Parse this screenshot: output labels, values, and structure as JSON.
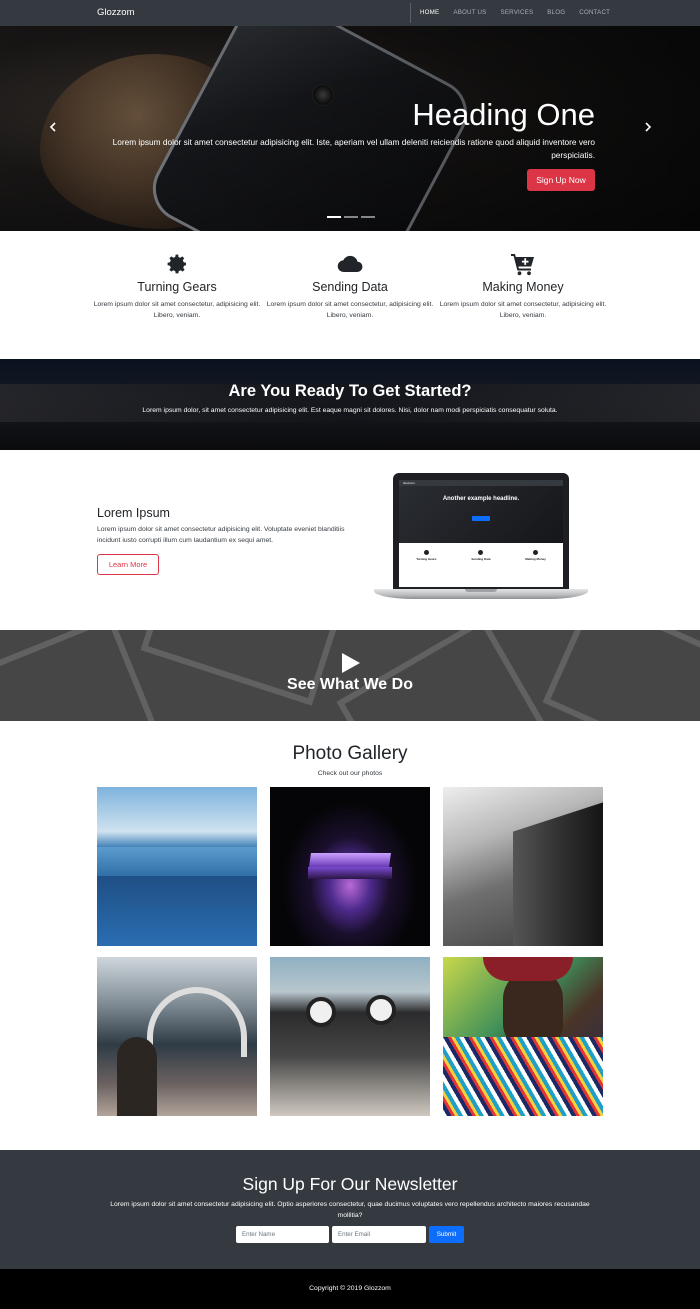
{
  "navbar": {
    "brand": "Glozzom",
    "links": [
      {
        "label": "HOME",
        "active": true
      },
      {
        "label": "ABOUT US",
        "active": false
      },
      {
        "label": "SERVICES",
        "active": false
      },
      {
        "label": "BLOG",
        "active": false
      },
      {
        "label": "CONTACT",
        "active": false
      }
    ]
  },
  "hero": {
    "title": "Heading One",
    "text": "Lorem ipsum dolor sit amet consectetur adipisicing elit. Iste, aperiam vel ullam deleniti reiciendis ratione quod aliquid inventore vero perspiciatis.",
    "button": "Sign Up Now",
    "prev_icon": "chevron-left-icon",
    "next_icon": "chevron-right-icon",
    "slide_count": 3,
    "active_slide": 1
  },
  "features": [
    {
      "icon": "gear-icon",
      "title": "Turning Gears",
      "text": "Lorem ipsum dolor sit amet consectetur, adipisicing elit. Libero, veniam."
    },
    {
      "icon": "cloud-icon",
      "title": "Sending Data",
      "text": "Lorem ipsum dolor sit amet consectetur, adipisicing elit. Libero, veniam."
    },
    {
      "icon": "cart-plus-icon",
      "title": "Making Money",
      "text": "Lorem ipsum dolor sit amet consectetur, adipisicing elit. Libero, veniam."
    }
  ],
  "ready": {
    "title": "Are You Ready To Get Started?",
    "text": "Lorem ipsum dolor, sit amet consectetur adipisicing elit. Est eaque magni sit dolores. Nisi, dolor nam modi perspiciatis consequatur soluta."
  },
  "info": {
    "title": "Lorem Ipsum",
    "text": "Lorem ipsum dolor sit amet consectetur adipisicing elit. Voluptate eveniet blanditiis incidunt iusto corrupti illum cum laudantium ex sequi amet.",
    "button": "Learn More"
  },
  "laptop_screen": {
    "brand": "Glozzom",
    "headline": "Another example headline.",
    "features": [
      "Turning Gears",
      "Sending Data",
      "Making Money"
    ]
  },
  "video": {
    "title": "See What We Do",
    "icon": "play-icon"
  },
  "gallery": {
    "title": "Photo Gallery",
    "subtitle": "Check out our photos"
  },
  "newsletter": {
    "title": "Sign Up For Our Newsletter",
    "text": "Lorem ipsum dolor sit amet consectetur adipisicing elit. Optio asperiores consectetur, quae ducimus voluptates vero repellendus architecto maiores recusandae mollitia?",
    "name_placeholder": "Enter Name",
    "email_placeholder": "Enter Email",
    "button": "Submit"
  },
  "footer": {
    "copyright": "Copyright © 2019 Glozzom"
  },
  "colors": {
    "dark": "#343a40",
    "danger": "#dc3545",
    "primary": "#0d6efd",
    "footer": "#000000"
  }
}
